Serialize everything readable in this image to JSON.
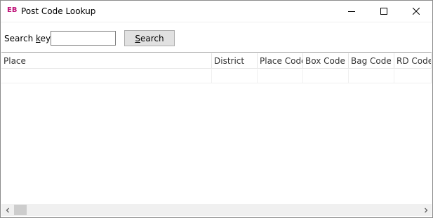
{
  "window": {
    "logo": "EB",
    "title": "Post Code Lookup"
  },
  "search": {
    "label_prefix": "Search ",
    "label_accel": "k",
    "label_suffix": "ey:",
    "value": "",
    "button_accel": "S",
    "button_rest": "earch"
  },
  "grid": {
    "columns": [
      "Place",
      "District",
      "Place Code",
      "Box Code",
      "Bag Code",
      "RD Code"
    ],
    "rows": []
  },
  "icons": {
    "minimize": "minimize-icon",
    "maximize": "maximize-icon",
    "close": "close-icon",
    "scroll_left": "chevron-left-icon",
    "scroll_right": "chevron-right-icon"
  }
}
